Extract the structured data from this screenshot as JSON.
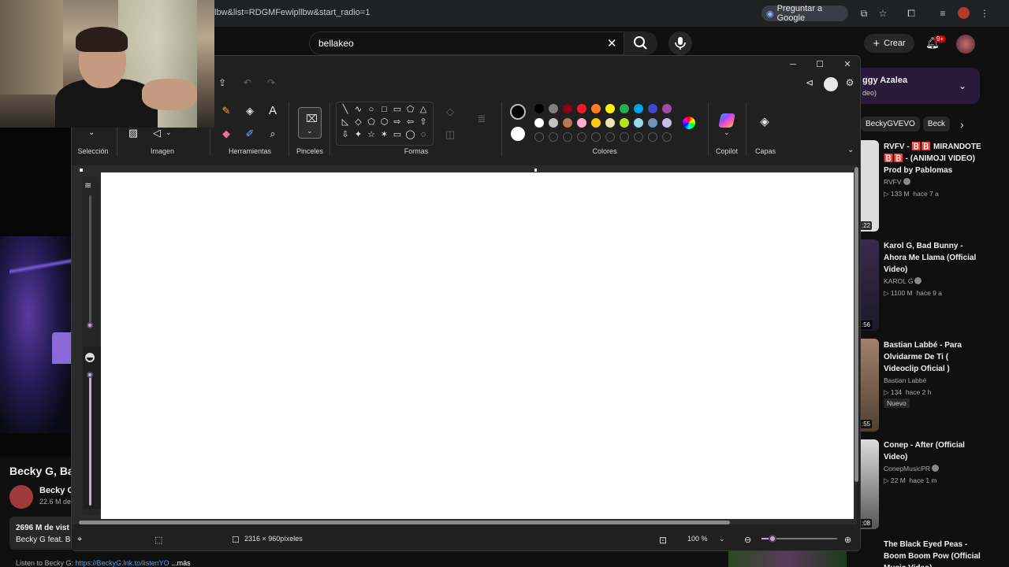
{
  "browser": {
    "url": "lbw&list=RDGMFewipllbw&start_radio=1",
    "ask_google": "Preguntar a Google",
    "ext_badge": ""
  },
  "youtube": {
    "search_query": "bellakeo",
    "create_label": "Crear",
    "notifications": "9+",
    "video_title": "Becky G, Ba",
    "channel_name": "Becky G",
    "channel_subs": "22.6 M de",
    "views": "2696 M de vist",
    "description_line": "Becky G feat. B",
    "description_more": "Listen to Becky G: ",
    "description_link": "https://BeckyG.lnk.to/listenYO",
    "more_label": "...más",
    "playlist": {
      "title": "ggy Azalea",
      "subtitle": "deo)"
    },
    "chips": [
      "BeckyGVEVO",
      "Beck"
    ],
    "recommended": [
      {
        "duration": ":22",
        "title": "RVFV - 🅱️🅱️ MIRANDOTE 🅱️🅱️ - (ANIMOJI VIDEO) Prod by Pablomas",
        "channel": "RVFV",
        "views": "▷ 133 M",
        "age": "hace 7 a",
        "badge": ""
      },
      {
        "duration": ":56",
        "title": "Karol G, Bad Bunny - Ahora Me Llama (Official Video)",
        "channel": "KAROL G",
        "views": "▷ 1100 M",
        "age": "hace 9 a",
        "badge": ""
      },
      {
        "duration": ":55",
        "title": "Bastian Labbé - Para Olvidarme De Ti ( Videoclip Oficial )",
        "channel": "Bastian Labbé",
        "views": "▷ 134",
        "age": "hace 2 h",
        "badge": "Nuevo"
      },
      {
        "duration": ":08",
        "title": "Conep - After (Official Video)",
        "channel": "ConepMusicPR",
        "views": "▷ 22 M",
        "age": "hace 1 m",
        "badge": ""
      },
      {
        "duration": "",
        "title": "The Black Eyed Peas - Boom Boom Pow (Official Music Video)",
        "channel": "",
        "views": "",
        "age": "",
        "badge": ""
      }
    ]
  },
  "paint": {
    "groups": {
      "selection": "Selección",
      "image": "Imagen",
      "tools": "Herramientas",
      "brushes": "Pinceles",
      "shapes": "Formas",
      "colors": "Colores",
      "copilot": "Copilot",
      "layers": "Capas"
    },
    "palette_row1": [
      "#000000",
      "#7f7f7f",
      "#880015",
      "#ed1c24",
      "#ff7f27",
      "#fff200",
      "#22b14c",
      "#00a2e8",
      "#3f48cc",
      "#a349a4"
    ],
    "palette_row2": [
      "#ffffff",
      "#c3c3c3",
      "#b97a57",
      "#ffaec9",
      "#ffc90e",
      "#efe4b0",
      "#b5e61d",
      "#99d9ea",
      "#7092be",
      "#c8bfe7"
    ],
    "status": {
      "canvas_size": "2316 × 960píxeles",
      "zoom": "100 %"
    }
  }
}
